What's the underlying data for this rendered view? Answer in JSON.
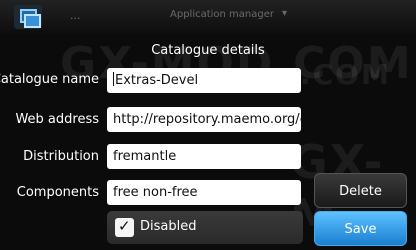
{
  "topbar": {
    "status": "...",
    "app_title": "Application manager",
    "dropdown": "▾"
  },
  "watermarks": [
    "GX-MOD.COM",
    ".COM",
    "GX-M"
  ],
  "dialog": {
    "title": "Catalogue details",
    "fields": {
      "catalogue_name": {
        "label": "Catalogue name",
        "value": "Extras-Devel"
      },
      "web_address": {
        "label": "Web address",
        "value": "http://repository.maemo.org/extr"
      },
      "distribution": {
        "label": "Distribution",
        "value": "fremantle"
      },
      "components": {
        "label": "Components",
        "value": "free  non-free"
      }
    },
    "disabled": {
      "label": "Disabled",
      "checked": true,
      "check_glyph": "✓"
    },
    "delete_label": "Delete",
    "save_label": "Save"
  }
}
